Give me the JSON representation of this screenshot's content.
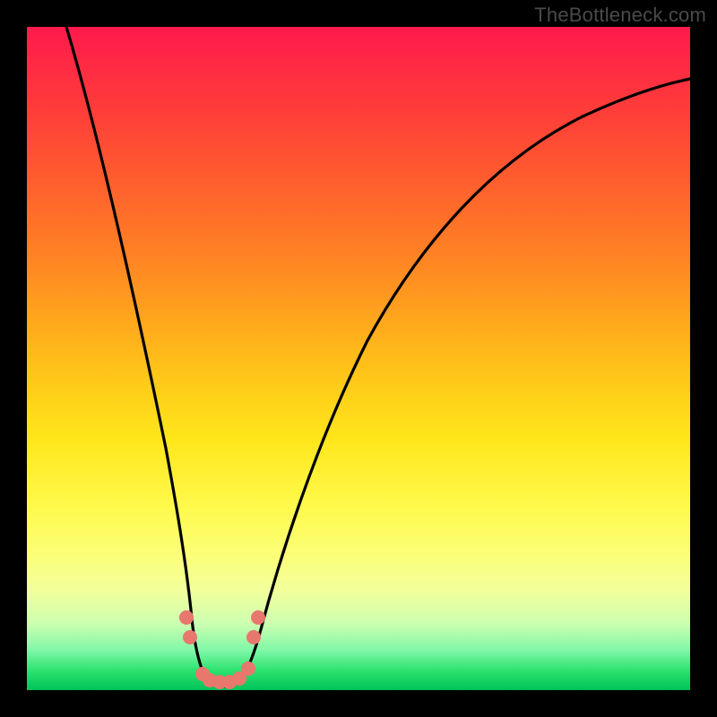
{
  "watermark": "TheBottleneck.com",
  "chart_data": {
    "type": "line",
    "title": "",
    "xlabel": "",
    "ylabel": "",
    "xlim": [
      0,
      100
    ],
    "ylim": [
      0,
      100
    ],
    "description": "Bottleneck curve over rainbow gradient; sharp V-shaped notch with minimum near x≈29, rising steeply to both sides. Background gradient encodes value: red (high bottleneck) at top, green (low) at bottom.",
    "series": [
      {
        "name": "bottleneck-curve",
        "x": [
          6,
          10,
          14,
          18,
          20,
          22,
          24,
          25,
          26,
          27,
          28,
          29,
          30,
          31,
          32,
          33,
          34,
          36,
          40,
          46,
          54,
          64,
          76,
          90,
          100
        ],
        "y": [
          100,
          86,
          72,
          56,
          46,
          36,
          24,
          16,
          9,
          4,
          1,
          0,
          0,
          1,
          2,
          4,
          7,
          13,
          26,
          42,
          56,
          68,
          78,
          85,
          88
        ]
      }
    ],
    "markers": {
      "name": "highlight-dots",
      "color": "#e8776e",
      "points": [
        {
          "x": 24.0,
          "y": 11
        },
        {
          "x": 24.6,
          "y": 8
        },
        {
          "x": 26.5,
          "y": 2.5
        },
        {
          "x": 27.5,
          "y": 1.5
        },
        {
          "x": 29.0,
          "y": 1.3
        },
        {
          "x": 30.5,
          "y": 1.3
        },
        {
          "x": 32.0,
          "y": 1.8
        },
        {
          "x": 33.4,
          "y": 3.2
        },
        {
          "x": 34.2,
          "y": 8
        },
        {
          "x": 34.8,
          "y": 11
        }
      ]
    },
    "gradient_stops": [
      {
        "pos": 0,
        "color": "#ff1a4d"
      },
      {
        "pos": 50,
        "color": "#ffe61a"
      },
      {
        "pos": 100,
        "color": "#00c25a"
      }
    ]
  }
}
